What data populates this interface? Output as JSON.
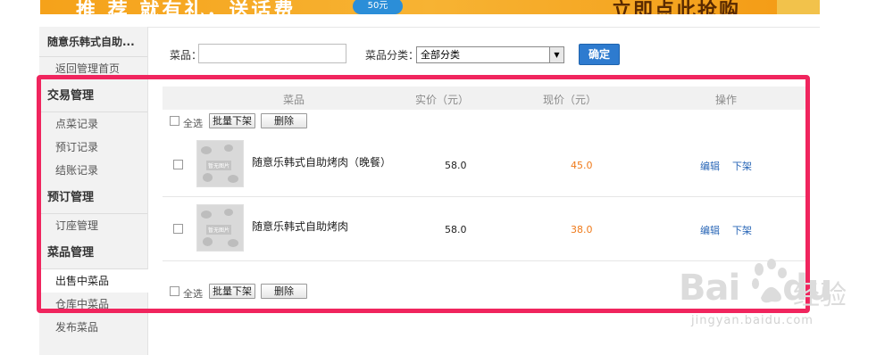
{
  "banner": {
    "text": "推 荐 就有礼，送话费",
    "badge": "50元",
    "cta": "立即点此抢购"
  },
  "sidebar": {
    "shop_name": "随意乐韩式自助...",
    "home_link": "返回管理首页",
    "groups": [
      {
        "title": "交易管理",
        "items": [
          "点菜记录",
          "预订记录",
          "结账记录"
        ]
      },
      {
        "title": "预订管理",
        "items": [
          "订座管理"
        ]
      },
      {
        "title": "菜品管理",
        "items": [
          "出售中菜品",
          "仓库中菜品",
          "发布菜品"
        ]
      }
    ],
    "active_item": "出售中菜品"
  },
  "filter": {
    "dish_label": "菜品：",
    "dish_value": "",
    "category_label": "菜品分类：",
    "category_value": "全部分类",
    "confirm_label": "确定"
  },
  "table": {
    "headers": [
      "菜品",
      "实价（元）",
      "现价（元）",
      "操作"
    ],
    "select_all_label": "全选",
    "batch_delist_label": "批量下架",
    "delete_label": "删除",
    "rows": [
      {
        "name": "随意乐韩式自助烤肉（晚餐）",
        "price": "58.0",
        "current_price": "45.0",
        "edit": "编辑",
        "delist": "下架",
        "thumb_text": "暂无图片"
      },
      {
        "name": "随意乐韩式自助烤肉",
        "price": "58.0",
        "current_price": "38.0",
        "edit": "编辑",
        "delist": "下架",
        "thumb_text": "暂无图片"
      }
    ]
  },
  "watermark": {
    "brand": "Bai",
    "brand_suffix": "du",
    "cn": "经验",
    "url": "jingyan.baidu.com"
  },
  "colors": {
    "highlight": "#f0255e",
    "confirm_button": "#2e7bcf",
    "current_price": "#ef7a1a",
    "action_link": "#2a67b7",
    "banner": "#f5a21a"
  }
}
